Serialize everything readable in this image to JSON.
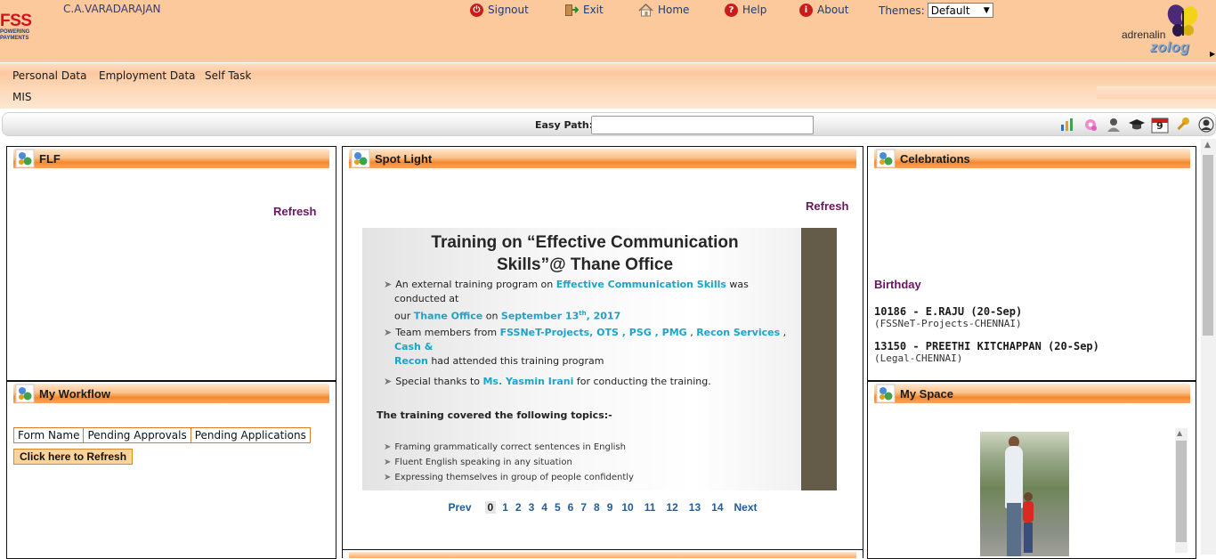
{
  "header": {
    "logo_text": "FSS",
    "logo_tagline": [
      "POWERING",
      "PAYMENTS"
    ],
    "user_name": "C.A.VARADARAJAN",
    "nav": [
      {
        "label": "Signout",
        "icon": "signout-icon"
      },
      {
        "label": "Exit",
        "icon": "exit-icon"
      },
      {
        "label": "Home",
        "icon": "home-icon"
      },
      {
        "label": "Help",
        "icon": "help-icon"
      },
      {
        "label": "About",
        "icon": "info-icon"
      }
    ],
    "themes_label": "Themes:",
    "themes_value": "Default",
    "brand_word": "adrenalin",
    "brand_sub": "zolog"
  },
  "menu": {
    "items": [
      "Personal Data",
      "Employment Data",
      "Self Task",
      "MIS"
    ]
  },
  "pathbar": {
    "label": "Easy Path:",
    "value": "",
    "tools": [
      "chart-icon",
      "settings-flower-icon",
      "profile-icon",
      "graduation-cap-icon",
      "calendar-icon",
      "key-icon",
      "avatar-icon"
    ],
    "calendar_day": "9"
  },
  "panels": {
    "flf": {
      "title": "FLF",
      "refresh": "Refresh"
    },
    "spotlight": {
      "title": "Spot Light",
      "refresh": "Refresh",
      "slide": {
        "title_line1": "Training on “Effective Communication",
        "title_line2": "Skills”@ Thane Office",
        "b1_a": "An external training program on ",
        "b1_hl1": "Effective Communication Skills",
        "b1_b": " was conducted at",
        "b1_c": "our ",
        "b1_hl2": "Thane Office",
        "b1_d": " on ",
        "b1_hl3": "September 13",
        "b1_sup": "th",
        "b1_hl4": ", 2017",
        "b2_a": "Team members from ",
        "b2_hl1": "FSSNeT-Projects, OTS , PSG , PMG",
        "b2_b": " , ",
        "b2_hl2": "Recon Services",
        "b2_c": " , ",
        "b2_hl3": "Cash &",
        "b2_hl4": "Recon",
        "b2_d": " had attended this training program",
        "b3_a": "Special thanks to ",
        "b3_hl": "Ms. Yasmin Irani",
        "b3_b": " for conducting the training.",
        "topics_heading": "The training covered the following topics:-",
        "topics": [
          "Framing grammatically correct sentences in English",
          "Fluent English speaking in any situation",
          "Expressing themselves in group of people confidently"
        ]
      },
      "pager": {
        "prev": "Prev",
        "pages": [
          "0",
          "1",
          "2",
          "3",
          "4",
          "5",
          "6",
          "7",
          "8",
          "9",
          "10",
          "11",
          "12",
          "13",
          "14"
        ],
        "current": "0",
        "next": "Next"
      }
    },
    "celebrations": {
      "title": "Celebrations",
      "birthday_heading": "Birthday",
      "entries": [
        {
          "name": "10186 - E.RAJU (20-Sep)",
          "dept": "(FSSNeT-Projects-CHENNAI)"
        },
        {
          "name": "13150 - PREETHI KITCHAPPAN (20-Sep)",
          "dept": "(Legal-CHENNAI)"
        }
      ]
    },
    "workflow": {
      "title": "My Workflow",
      "columns": [
        "Form Name",
        "Pending Approvals",
        "Pending Applications"
      ],
      "refresh_button": "Click here to Refresh"
    },
    "myspace": {
      "title": "My Space"
    }
  }
}
